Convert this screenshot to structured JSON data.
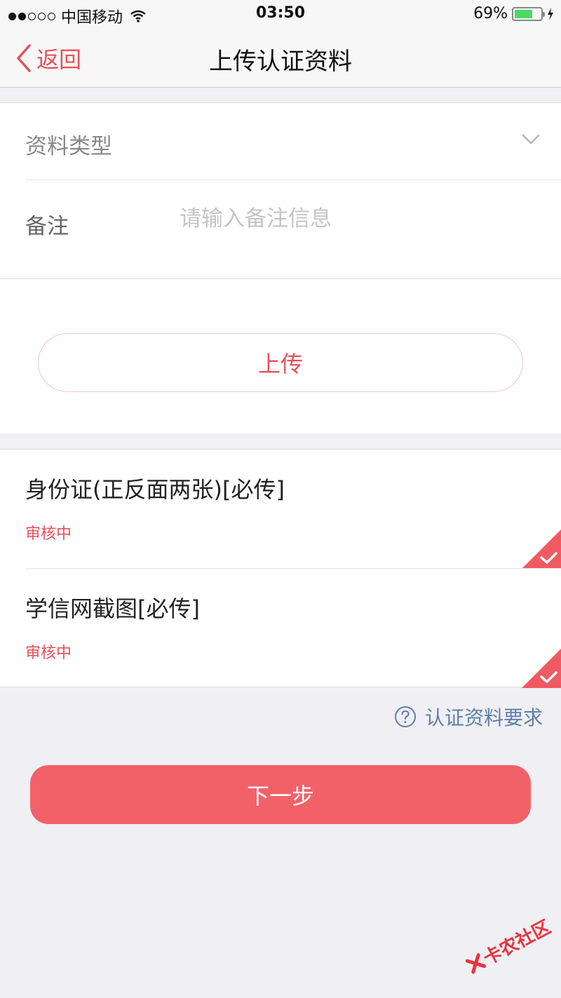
{
  "status_bar": {
    "carrier": "中国移动",
    "time": "03:50",
    "battery_percent": "69%",
    "battery_level": 0.69
  },
  "nav": {
    "back_label": "返回",
    "title": "上传认证资料"
  },
  "form": {
    "type_label": "资料类型",
    "note_label": "备注",
    "note_placeholder": "请输入备注信息",
    "upload_label": "上传"
  },
  "documents": [
    {
      "title": "身份证(正反面两张)[必传]",
      "status": "审核中"
    },
    {
      "title": "学信网截图[必传]",
      "status": "审核中"
    }
  ],
  "requirements_label": "认证资料要求",
  "next_label": "下一步",
  "watermark_text": "卡农社区",
  "colors": {
    "accent": "#e8505b",
    "next_button": "#f26168",
    "link": "#5d7fa8",
    "background": "#efeff4"
  }
}
